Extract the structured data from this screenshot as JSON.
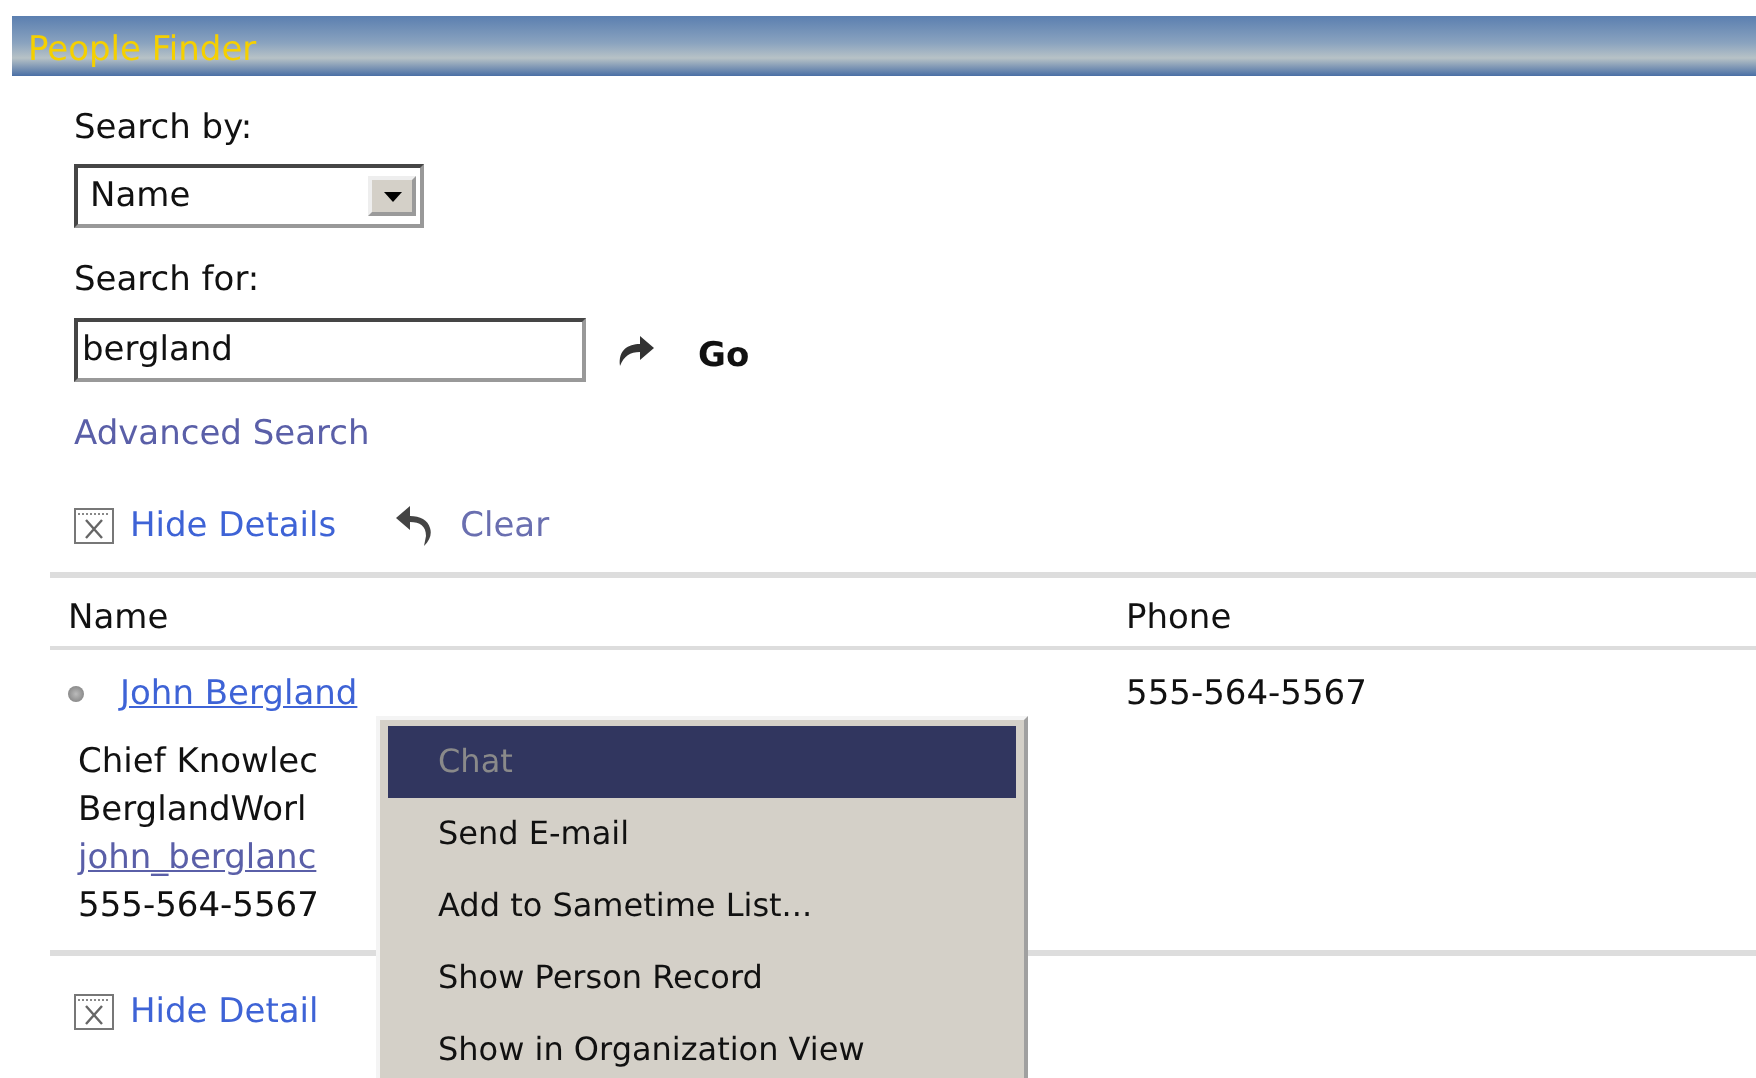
{
  "window": {
    "title": "People Finder"
  },
  "search": {
    "by_label": "Search by:",
    "by_value": "Name",
    "for_label": "Search for:",
    "for_value": "bergland",
    "go": "Go",
    "advanced": "Advanced Search"
  },
  "actions": {
    "hide_details": "Hide Details",
    "clear": "Clear"
  },
  "table": {
    "columns": [
      "Name",
      "Phone"
    ],
    "rows": [
      {
        "name": "John Bergland",
        "phone": "555-564-5567",
        "details": [
          "Chief Knowlec",
          "BerglandWorl"
        ],
        "email": "john_berglanc",
        "detail_phone": "555-564-5567"
      }
    ]
  },
  "footer": {
    "hide_details": "Hide Detail"
  },
  "context_menu": {
    "items": [
      {
        "label": "Chat",
        "selected": true,
        "disabled": true
      },
      {
        "label": "Send E-mail",
        "selected": false,
        "disabled": false
      },
      {
        "label": "Add to Sametime List...",
        "selected": false,
        "disabled": false
      },
      {
        "label": "Show Person Record",
        "selected": false,
        "disabled": false
      },
      {
        "label": "Show in Organization View",
        "selected": false,
        "disabled": false
      }
    ]
  }
}
